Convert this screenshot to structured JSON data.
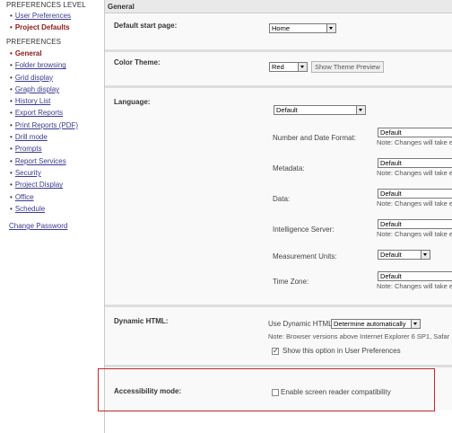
{
  "sidebar": {
    "level_heading": "PREFERENCES LEVEL",
    "level_items": [
      {
        "label": "User Preferences",
        "active": false
      },
      {
        "label": "Project Defaults",
        "active": true
      }
    ],
    "prefs_heading": "PREFERENCES",
    "pref_items": [
      {
        "label": "General",
        "active": true
      },
      {
        "label": "Folder browsing",
        "active": false
      },
      {
        "label": "Grid display",
        "active": false
      },
      {
        "label": "Graph display",
        "active": false
      },
      {
        "label": "History List",
        "active": false
      },
      {
        "label": "Export Reports",
        "active": false
      },
      {
        "label": "Print Reports (PDF)",
        "active": false
      },
      {
        "label": "Drill mode",
        "active": false
      },
      {
        "label": "Prompts",
        "active": false
      },
      {
        "label": "Report Services",
        "active": false
      },
      {
        "label": "Security",
        "active": false
      },
      {
        "label": "Project Display",
        "active": false
      },
      {
        "label": "Office",
        "active": false
      },
      {
        "label": "Schedule",
        "active": false
      }
    ],
    "change_password": "Change Password"
  },
  "main": {
    "title": "General",
    "default_start": {
      "label": "Default start page:",
      "value": "Home"
    },
    "color_theme": {
      "label": "Color Theme:",
      "value": "Red",
      "preview_button": "Show Theme Preview"
    },
    "language": {
      "label": "Language:",
      "value": "Default",
      "rows": [
        {
          "label": "Number and Date Format:",
          "value": "Default",
          "note": "Note: Changes will take e"
        },
        {
          "label": "Metadata:",
          "value": "Default",
          "note": "Note: Changes will take e"
        },
        {
          "label": "Data:",
          "value": "Default",
          "note": "Note: Changes will take e"
        },
        {
          "label": "Intelligence Server:",
          "value": "Default",
          "note": "Note: Changes will take e"
        },
        {
          "label": "Measurement Units:",
          "value": "Default",
          "note": ""
        },
        {
          "label": "Time Zone:",
          "value": "Default",
          "note": "Note: Changes will take e"
        }
      ]
    },
    "dynamic_html": {
      "label": "Dynamic HTML:",
      "use_label": "Use Dynamic HTML?",
      "value": "Determine automatically",
      "note": "Note: Browser versions above Internet Explorer 6 SP1, Safar",
      "show_option": "Show this option in User Preferences",
      "show_option_checked": true
    },
    "accessibility": {
      "label": "Accessibility mode:",
      "option": "Enable screen reader compatibility",
      "checked": false
    }
  },
  "colors": {
    "accent": "#8b1a1a",
    "highlight": "#c0282d",
    "link": "#3b3b8f"
  }
}
